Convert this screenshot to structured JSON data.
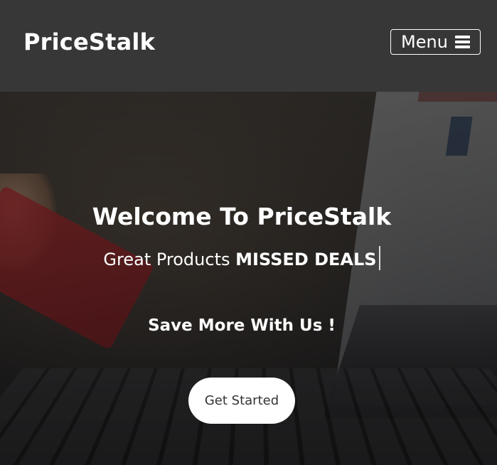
{
  "navbar": {
    "brand": "PriceStalk",
    "menu_label": "Menu",
    "menu_icon": "hamburger-icon"
  },
  "hero": {
    "title": "Welcome To PriceStalk",
    "subtitle_prefix": "Great Products",
    "subtitle_highlight": "MISSED DEALS",
    "tagline": "Save More With Us !",
    "cta_label": "Get Started"
  },
  "colors": {
    "navbar_bg": "#373737",
    "text": "#ffffff",
    "cta_bg": "#ffffff",
    "cta_text": "#333333"
  }
}
